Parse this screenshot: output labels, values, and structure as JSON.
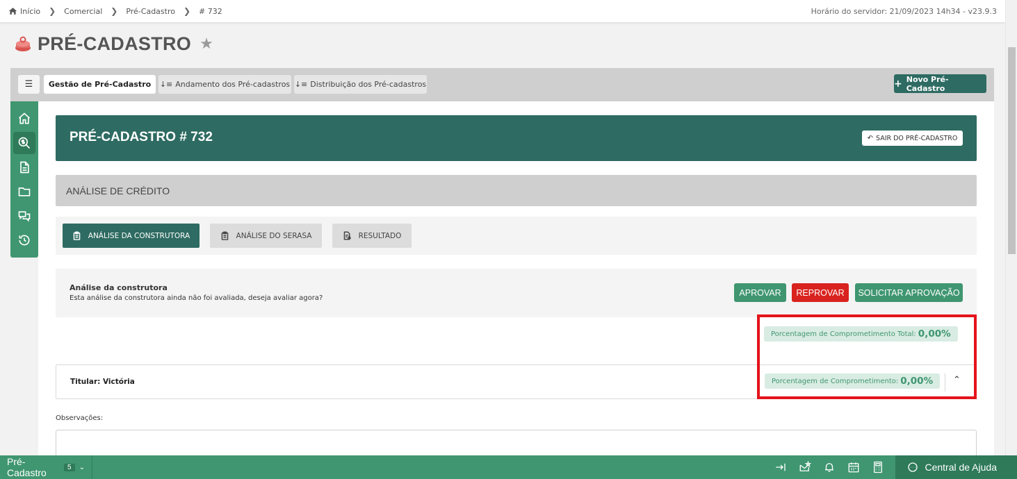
{
  "breadcrumb": {
    "items": [
      "Início",
      "Comercial",
      "Pré-Cadastro",
      "# 732"
    ]
  },
  "server_time": "Horário do servidor: 21/09/2023 14h34 - v23.9.3",
  "page": {
    "title": "PRÉ-CADASTRO",
    "favorite_icon": "star-icon",
    "module_icon": "module-logo-icon"
  },
  "tabs": {
    "menu_icon": "☰",
    "items": [
      {
        "label": "Gestão de Pré-Cadastro",
        "active": true
      },
      {
        "label": "Andamento dos Pré-cadastros",
        "icon": "sort-icon"
      },
      {
        "label": "Distribuição dos Pré-cadastros",
        "icon": "sort-icon"
      }
    ],
    "new_button": "Novo Pré-Cadastro"
  },
  "sidenav": {
    "items": [
      "home-icon",
      "credit-search-icon",
      "document-icon",
      "folder-icon",
      "chat-icon",
      "history-icon"
    ],
    "active_index": 1
  },
  "header": {
    "title": "PRÉ-CADASTRO # 732",
    "exit_button": "SAIR DO PRÉ-CADASTRO"
  },
  "section": {
    "title": "ANÁLISE DE CRÉDITO"
  },
  "subtabs": [
    {
      "label": "ANÁLISE DA CONSTRUTORA",
      "active": true
    },
    {
      "label": "ANÁLISE DO SERASA",
      "active": false
    },
    {
      "label": "RESULTADO",
      "active": false
    }
  ],
  "analysis": {
    "title": "Análise da construtora",
    "description": "Esta análise da construtora ainda não foi avaliada, deseja avaliar agora?",
    "approve": "APROVAR",
    "reject": "REPROVAR",
    "request": "SOLICITAR APROVAÇÃO"
  },
  "commitment": {
    "total_label": "Porcentagem de Comprometimento Total:",
    "total_value": "0,00%",
    "label": "Porcentagem de Comprometimento:",
    "value": "0,00%"
  },
  "titular": {
    "label": "Titular: Victória"
  },
  "observations": {
    "label": "Observações:"
  },
  "footer": {
    "module": "Pré-Cadastro",
    "count": "5",
    "help": "Central de Ajuda"
  },
  "colors": {
    "primary": "#2e6b62",
    "accent": "#3f9670",
    "danger": "#d9231f",
    "highlight": "#e4141b"
  }
}
